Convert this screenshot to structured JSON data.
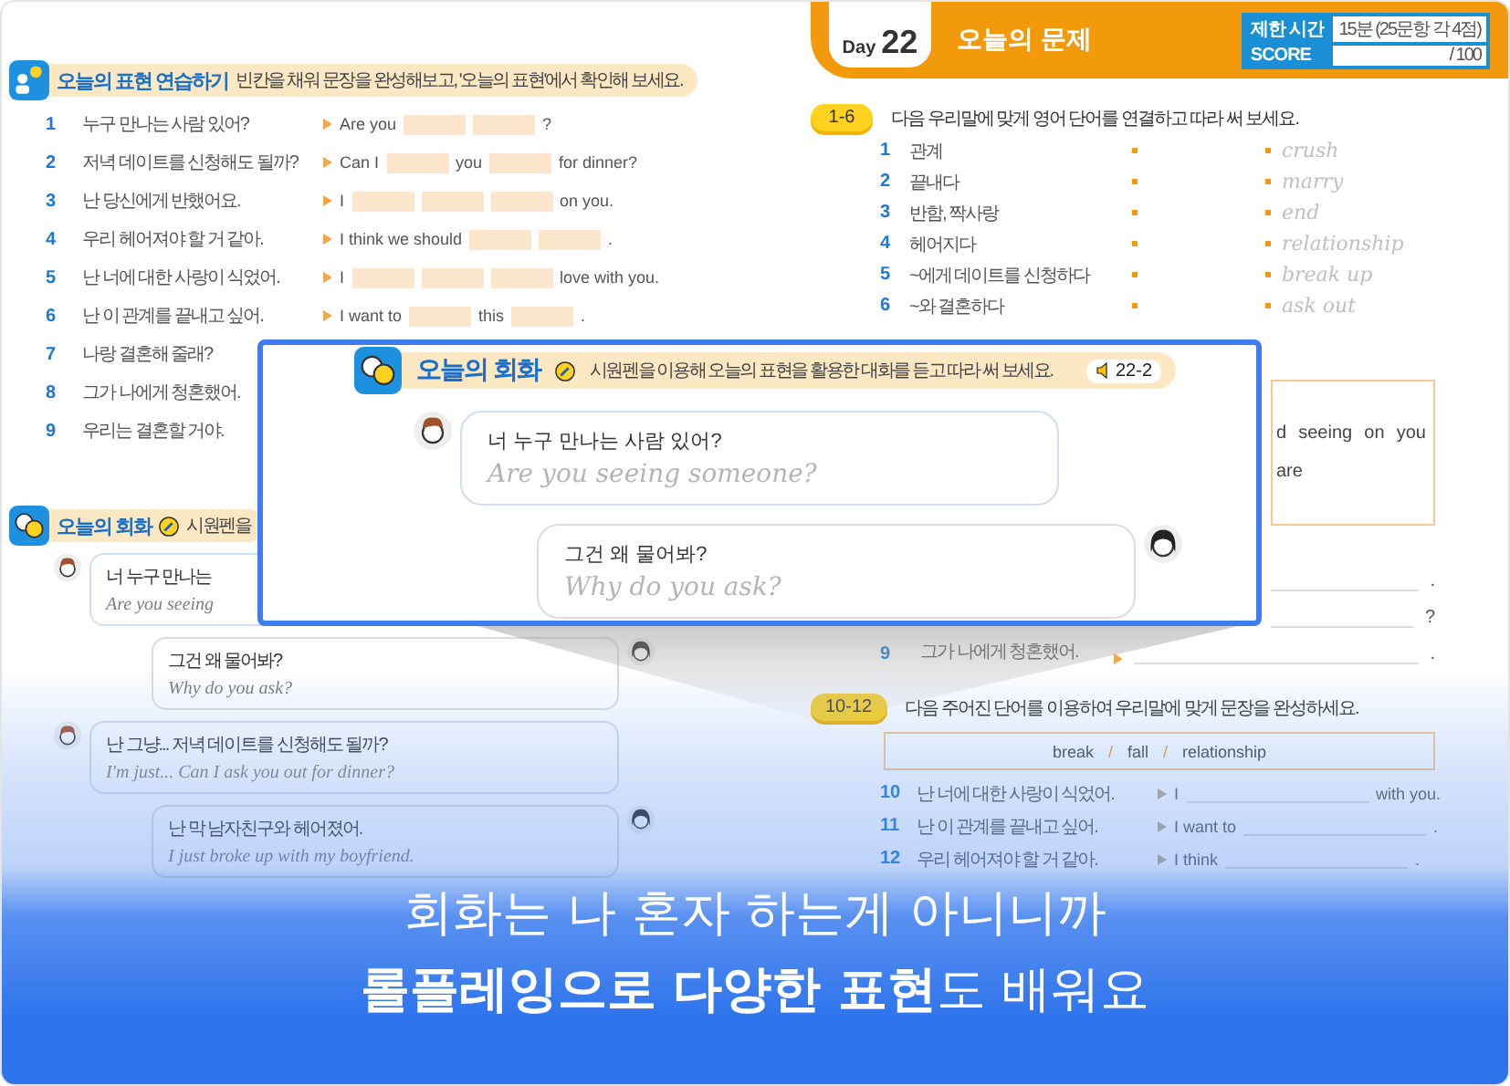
{
  "left_page": {
    "practice": {
      "title": "오늘의 표현 연습하기",
      "instruction": "빈칸을 채워 문장을 완성해보고, '오늘의 표현'에서 확인해 보세요.",
      "rows": [
        {
          "number": "1",
          "korean": "누구 만나는 사람 있어?",
          "english": [
            {
              "kind": "text",
              "text": "Are you"
            },
            {
              "kind": "blank"
            },
            {
              "kind": "blank"
            },
            {
              "kind": "text",
              "text": "?"
            }
          ]
        },
        {
          "number": "2",
          "korean": "저녁 데이트를 신청해도 될까?",
          "english": [
            {
              "kind": "text",
              "text": "Can I"
            },
            {
              "kind": "blank"
            },
            {
              "kind": "text",
              "text": "you"
            },
            {
              "kind": "blank"
            },
            {
              "kind": "text",
              "text": "for dinner?"
            }
          ]
        },
        {
          "number": "3",
          "korean": "난 당신에게 반했어요.",
          "english": [
            {
              "kind": "text",
              "text": "I"
            },
            {
              "kind": "blank"
            },
            {
              "kind": "blank"
            },
            {
              "kind": "blank"
            },
            {
              "kind": "text",
              "text": "on you."
            }
          ]
        },
        {
          "number": "4",
          "korean": "우리 헤어져야 할 거 같아.",
          "english": [
            {
              "kind": "text",
              "text": "I think we should"
            },
            {
              "kind": "blank"
            },
            {
              "kind": "blank"
            },
            {
              "kind": "text",
              "text": "."
            }
          ]
        },
        {
          "number": "5",
          "korean": "난 너에 대한 사랑이 식었어.",
          "english": [
            {
              "kind": "text",
              "text": "I"
            },
            {
              "kind": "blank"
            },
            {
              "kind": "blank"
            },
            {
              "kind": "blank"
            },
            {
              "kind": "text",
              "text": "love with you."
            }
          ]
        },
        {
          "number": "6",
          "korean": "난 이 관계를 끝내고 싶어.",
          "english": [
            {
              "kind": "text",
              "text": "I want to"
            },
            {
              "kind": "blank"
            },
            {
              "kind": "text",
              "text": "this"
            },
            {
              "kind": "blank"
            },
            {
              "kind": "text",
              "text": "."
            }
          ]
        },
        {
          "number": "7",
          "korean": "나랑 결혼해 줄래?"
        },
        {
          "number": "8",
          "korean": "그가 나에게 청혼했어."
        },
        {
          "number": "9",
          "korean": "우리는 결혼할 거야."
        }
      ]
    },
    "conversation": {
      "title": "오늘의 회화",
      "instruction": "시원펜을",
      "lines": [
        {
          "kind": "boy",
          "korean": "너 누구 만나는",
          "english": "Are you seeing"
        },
        {
          "kind": "girl",
          "korean": "그건 왜 물어봐?",
          "english": "Why do you ask?"
        },
        {
          "kind": "boy",
          "korean": "난 그냥... 저녁 데이트를 신청해도 될까?",
          "english": "I'm just... Can I ask you out for dinner?"
        },
        {
          "kind": "girl",
          "korean": "난 막 남자친구와 헤어졌어.",
          "english": "I just broke up with my boyfriend."
        }
      ]
    }
  },
  "right_page": {
    "day_label": "Day",
    "day_number": "22",
    "title": "오늘의 문제",
    "limit_label": "제한 시간",
    "limit_value": "15분 (25문항 각 4점)",
    "score_label": "SCORE",
    "score_value": "/ 100",
    "matching": {
      "badge": "1-6",
      "instruction": "다음 우리말에 맞게 영어 단어를 연결하고 따라 써 보세요.",
      "rows": [
        {
          "number": "1",
          "korean": "관계",
          "english": "crush"
        },
        {
          "number": "2",
          "korean": "끝내다",
          "english": "marry"
        },
        {
          "number": "3",
          "korean": "반함, 짝사랑",
          "english": "end"
        },
        {
          "number": "4",
          "korean": "헤어지다",
          "english": "relationship"
        },
        {
          "number": "5",
          "korean": "~에게 데이트를 신청하다",
          "english": "break up"
        },
        {
          "number": "6",
          "korean": "~와 결혼하다",
          "english": "ask out"
        }
      ]
    },
    "word_box": {
      "line_1": [
        "d",
        "seeing",
        "on",
        "you"
      ],
      "line_2": "are"
    },
    "writing_rows": [
      {
        "end": "."
      },
      {
        "end": "?"
      },
      {
        "number": "9",
        "korean": "그가 나에게 청혼했어.",
        "end": "."
      }
    ],
    "composition": {
      "badge": "10-12",
      "instruction": "다음 주어진 단어를 이용하여 우리말에 맞게 문장을 완성하세요.",
      "separator": "/",
      "word_bank": [
        "break",
        "fall",
        "relationship"
      ],
      "rows": [
        {
          "number": "10",
          "korean": "난 너에 대한 사랑이 식었어.",
          "before": "I",
          "after": "with you."
        },
        {
          "number": "11",
          "korean": "난 이 관계를 끝내고 싶어.",
          "before": "I want to",
          "after": "."
        },
        {
          "number": "12",
          "korean": "우리 헤어져야 할 거 같아.",
          "before": "I think",
          "after": "."
        }
      ]
    }
  },
  "popup": {
    "title": "오늘의 회화",
    "instruction": "시원펜을 이용해 오늘의 표현을 활용한 대화를 듣고 따라 써 보세요.",
    "audio": "22-2",
    "lines": [
      {
        "kind": "boy",
        "korean": "너 누구 만나는 사람 있어?",
        "english": "Are you seeing someone?"
      },
      {
        "kind": "girl",
        "korean": "그건 왜 물어봐?",
        "english": "Why do you ask?"
      }
    ]
  },
  "caption": {
    "line_1": "회화는 나 혼자 하는게 아니니까",
    "line_2": "**롤플레잉으로 다양한 표현**도 배워요"
  }
}
